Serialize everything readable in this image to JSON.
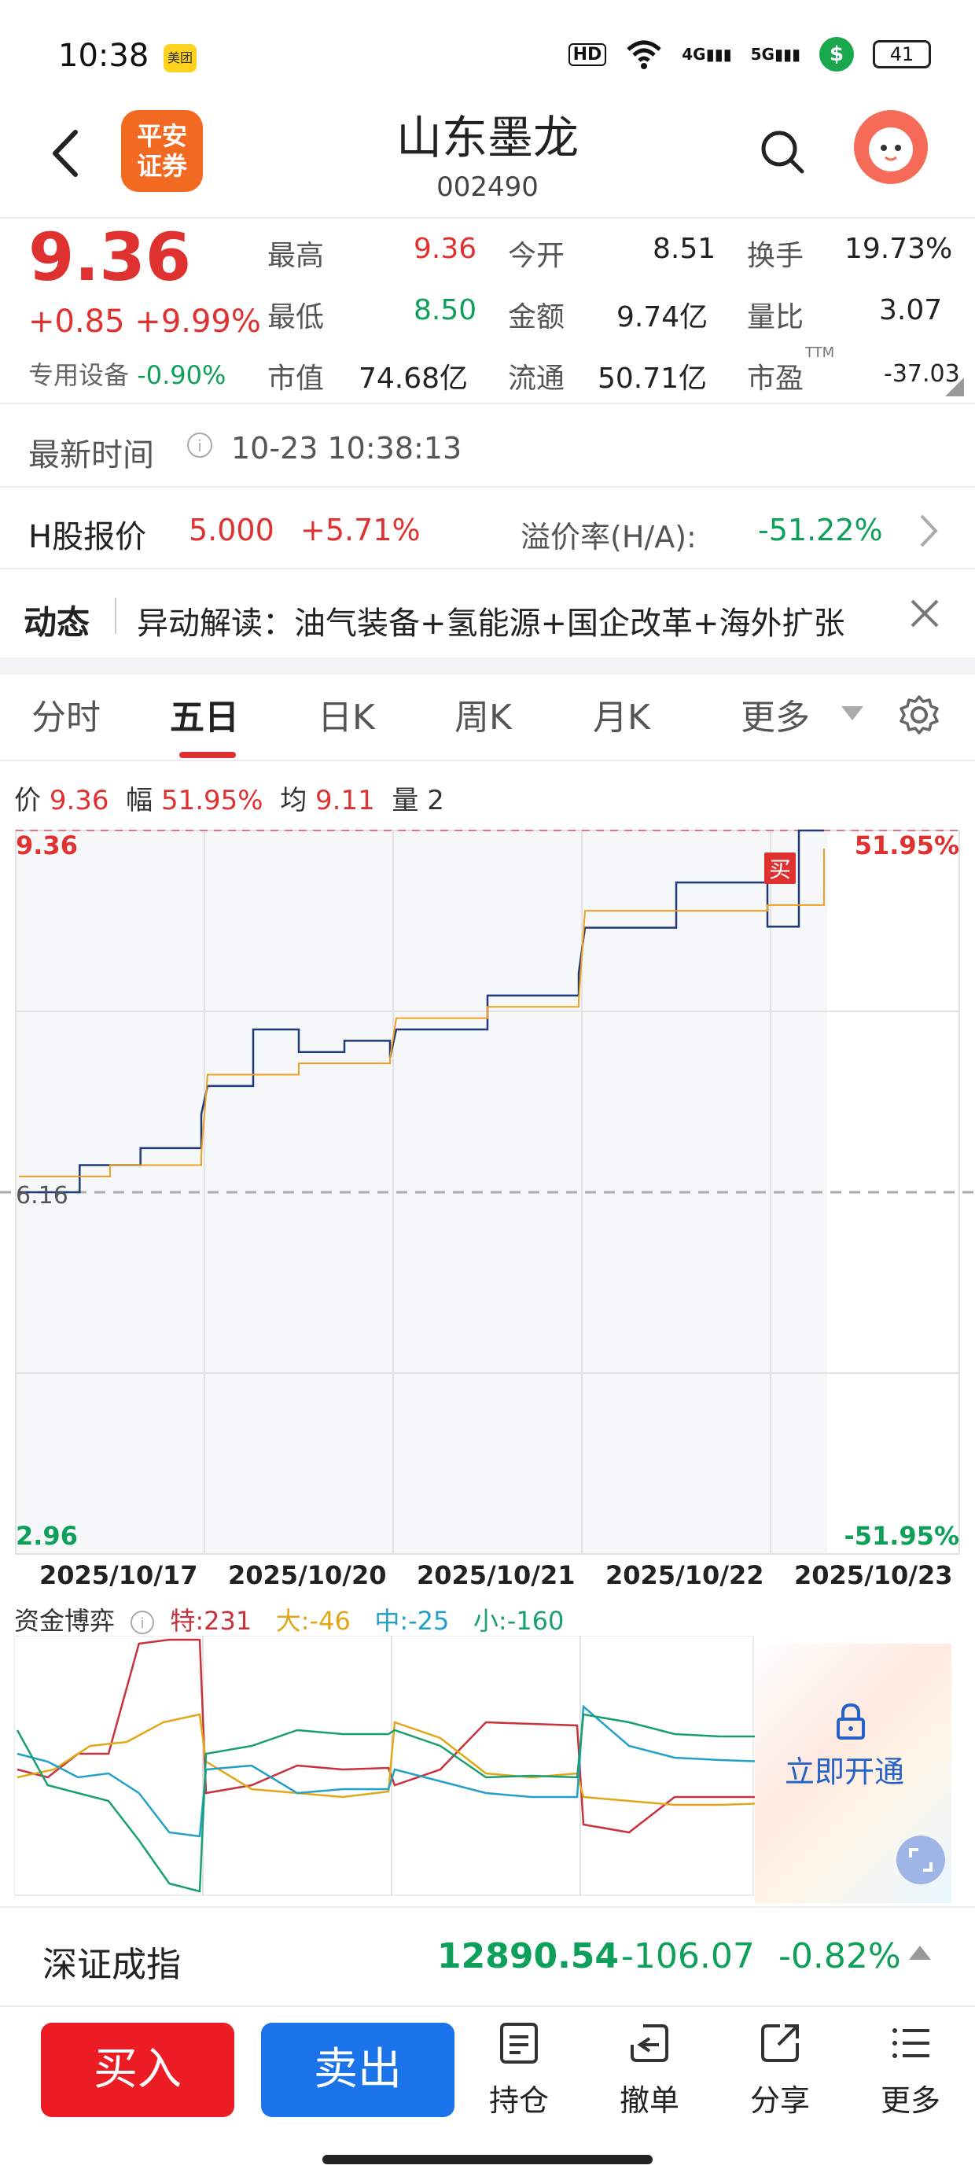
{
  "status_bar": {
    "time": "10:38",
    "meituan": "美团",
    "hd": "HD",
    "net1": "4G",
    "net2": "5G",
    "battery": "41"
  },
  "header": {
    "logo_line1": "平安",
    "logo_line2": "证券",
    "name": "山东墨龙",
    "code": "002490"
  },
  "quote": {
    "price": "9.36",
    "change": "+0.85",
    "change_pct": "+9.99%",
    "sector_label": "专用设备",
    "sector_pct": "-0.90%",
    "high_label": "最高",
    "high": "9.36",
    "open_label": "今开",
    "open": "8.51",
    "turnover_label": "换手",
    "turnover": "19.73%",
    "low_label": "最低",
    "low": "8.50",
    "amount_label": "金额",
    "amount": "9.74亿",
    "vol_ratio_label": "量比",
    "vol_ratio": "3.07",
    "mcap_label": "市值",
    "mcap": "74.68亿",
    "float_label": "流通",
    "float": "50.71亿",
    "pe_label": "市盈",
    "pe_sup": "TTM",
    "pe": "-37.03"
  },
  "latest": {
    "label": "最新时间",
    "value": "10-23 10:38:13"
  },
  "hshare": {
    "label": "H股报价",
    "price": "5.000",
    "pct": "+5.71%",
    "premium_label": "溢价率(H/A):",
    "premium": "-51.22%"
  },
  "news": {
    "label": "动态",
    "text": "异动解读：油气装备+氢能源+国企改革+海外扩张"
  },
  "tabs": [
    "分时",
    "五日",
    "日K",
    "周K",
    "月K",
    "更多"
  ],
  "chart_info": {
    "price_label": "价",
    "price": "9.36",
    "amp_label": "幅",
    "amp": "51.95%",
    "avg_label": "均",
    "avg": "9.11",
    "vol_label": "量",
    "vol": "2"
  },
  "chart_data": {
    "type": "line",
    "x": [
      "2025/10/17",
      "2025/10/20",
      "2025/10/21",
      "2025/10/22",
      "2025/10/23"
    ],
    "y_max_label": "9.36",
    "y_mid_label": "6.16",
    "y_min_label": "2.96",
    "pct_max_label": "51.95%",
    "pct_min_label": "-51.95%",
    "ylim": [
      2.96,
      9.36
    ],
    "prev_close": 6.16,
    "buy_marker": "买",
    "series": [
      {
        "color": "#1f3a7a",
        "day_values": [
          [
            6.16,
            6.4,
            6.55,
            6.85
          ],
          [
            7.1,
            7.6,
            7.4,
            7.5,
            7.35
          ],
          [
            7.6,
            7.9,
            8.1
          ],
          [
            8.5,
            8.9,
            8.51
          ],
          [
            8.51,
            9.36,
            9.36
          ]
        ]
      },
      {
        "color": "#f0a020",
        "day_values": [
          [
            6.3,
            6.4,
            6.5
          ],
          [
            7.2,
            7.3,
            7.35
          ],
          [
            7.7,
            7.8,
            7.85
          ],
          [
            8.65,
            8.7
          ],
          [
            8.7,
            9.2
          ]
        ]
      }
    ]
  },
  "flow": {
    "label": "资金博弈",
    "te_label": "特:",
    "te": "231",
    "da_label": "大:",
    "da": "-46",
    "zhong_label": "中:",
    "zhong": "-25",
    "xiao_label": "小:",
    "xiao": "-160",
    "unlock": "立即开通",
    "colors": {
      "te": "#c8323c",
      "da": "#e0a818",
      "zhong": "#22a0c8",
      "xiao": "#19a070"
    }
  },
  "index": {
    "name": "深证成指",
    "value": "12890.54",
    "change": "-106.07",
    "pct": "-0.82%"
  },
  "bottom": {
    "buy": "买入",
    "sell": "卖出",
    "tools": [
      "持仓",
      "撤单",
      "分享",
      "更多"
    ]
  }
}
